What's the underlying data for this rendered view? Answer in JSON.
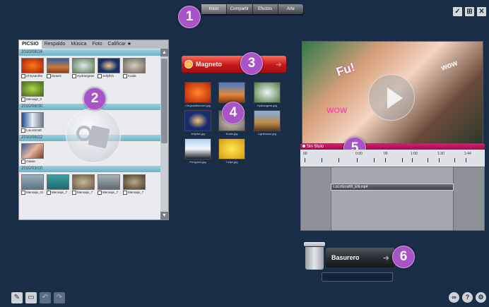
{
  "top_tabs": [
    {
      "label": "Inicio",
      "active": true
    },
    {
      "label": "Compartir",
      "active": false
    },
    {
      "label": "Efectos",
      "active": false
    },
    {
      "label": "Arte",
      "active": false
    }
  ],
  "badges": [
    "1",
    "2",
    "3",
    "4",
    "5",
    "6"
  ],
  "window_buttons": {
    "check": "✓",
    "grid": "⊞",
    "close": "✕"
  },
  "library": {
    "tabs": [
      {
        "label": "PICSIO",
        "active": true
      },
      {
        "label": "Respaldo",
        "active": false
      },
      {
        "label": "Música",
        "active": false
      },
      {
        "label": "Foto",
        "active": false
      },
      {
        "label": "Calificar ★",
        "active": false
      }
    ],
    "groups": [
      {
        "date": "2010/08/16",
        "items": [
          "Chrysanthe",
          "Desert",
          "Hydrangeas",
          "Jellyfish",
          "Koala",
          "Mensaje_0"
        ]
      },
      {
        "date": "2010/08/30",
        "items": [
          "LoLoScraft"
        ]
      },
      {
        "date": "2010/08/22",
        "items": [
          "maww"
        ]
      },
      {
        "date": "2010/03/10",
        "items": [
          "Mensaje_01",
          "Mensaje_7",
          "Mensaje_7",
          "Mensaje_7",
          "Mensaje_7"
        ]
      }
    ]
  },
  "magneto": {
    "label": "Magneto"
  },
  "magneto_items": [
    "Chrysanthemum.jpg",
    "Desert.jpg",
    "Hydrangeas.jpg",
    "Jellyfish.jpg",
    "Koala.jpg",
    "Lighthouse.jpg",
    "Penguins.jpg",
    "Tulips.jpg"
  ],
  "preview": {
    "doodle": "Fu!",
    "wow1": "WOW",
    "wow2": "wow"
  },
  "style_bar": {
    "label": "Sin Stulo"
  },
  "ruler_labels": [
    "00",
    "0:30",
    "00",
    "1:00",
    "1:30",
    "1:44"
  ],
  "timeline": {
    "clip_label": "LoLoScraftX_EN.mp4"
  },
  "trash": {
    "label": "Basurero"
  },
  "bottom_left_icons": [
    "undo-icon",
    "redo-icon",
    "back-icon",
    "forward-icon"
  ],
  "bottom_right_icons": [
    "link-icon",
    "help-icon",
    "settings-icon"
  ],
  "colors": {
    "background": "#1a2d47",
    "accent": "#a854c8",
    "magneto_red": "#c61818",
    "style_bar": "#d81b6f"
  }
}
